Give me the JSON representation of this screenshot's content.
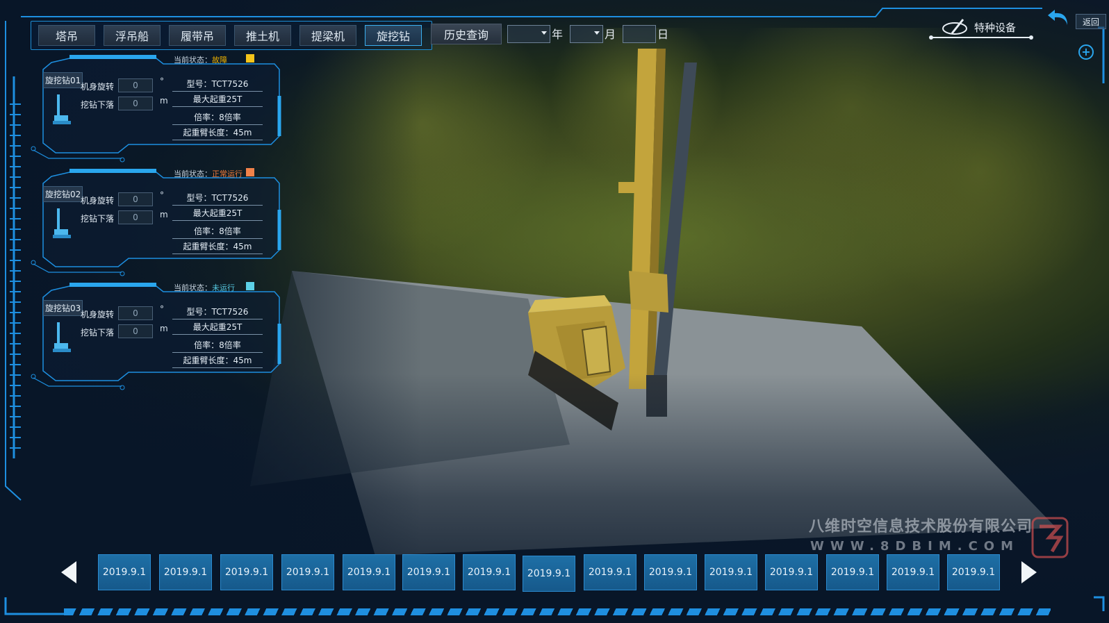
{
  "tabs": [
    {
      "label": "塔吊"
    },
    {
      "label": "浮吊船"
    },
    {
      "label": "履带吊"
    },
    {
      "label": "推土机"
    },
    {
      "label": "提梁机"
    },
    {
      "label": "旋挖钻",
      "active": true
    }
  ],
  "history": {
    "button_label": "历史查询",
    "year_unit": "年",
    "month_unit": "月",
    "day_unit": "日"
  },
  "header_right": {
    "brand_label": "特种设备",
    "back_label": "返回"
  },
  "devices": [
    {
      "status_prefix": "当前状态：",
      "status": "故障",
      "status_color": "#f0b400",
      "swatch_color": "#f4c41a",
      "name": "旋挖钻01",
      "rotation_label": "机身旋转",
      "rotation_value": "0",
      "rotation_unit": "°",
      "drop_label": "挖钻下落",
      "drop_value": "0",
      "drop_unit": "m",
      "model": "型号：TCT7526",
      "max_load": "最大起重25T",
      "ratio": "倍率：8倍率",
      "boom": "起重臂长度：45m"
    },
    {
      "status_prefix": "当前状态：",
      "status": "正常运行",
      "status_color": "#f07a3a",
      "swatch_color": "#f0824a",
      "name": "旋挖钻02",
      "rotation_label": "机身旋转",
      "rotation_value": "0",
      "rotation_unit": "°",
      "drop_label": "挖钻下落",
      "drop_value": "0",
      "drop_unit": "m",
      "model": "型号：TCT7526",
      "max_load": "最大起重25T",
      "ratio": "倍率：8倍率",
      "boom": "起重臂长度：45m"
    },
    {
      "status_prefix": "当前状态：",
      "status": "未运行",
      "status_color": "#56c8e0",
      "swatch_color": "#5cd0e6",
      "name": "旋挖钻03",
      "rotation_label": "机身旋转",
      "rotation_value": "0",
      "rotation_unit": "°",
      "drop_label": "挖钻下落",
      "drop_value": "0",
      "drop_unit": "m",
      "model": "型号：TCT7526",
      "max_load": "最大起重25T",
      "ratio": "倍率：8倍率",
      "boom": "起重臂长度：45m"
    }
  ],
  "timeline": {
    "dates": [
      "2019.9.1",
      "2019.9.1",
      "2019.9.1",
      "2019.9.1",
      "2019.9.1",
      "2019.9.1",
      "2019.9.1",
      "2019.9.1",
      "2019.9.1",
      "2019.9.1",
      "2019.9.1",
      "2019.9.1",
      "2019.9.1",
      "2019.9.1",
      "2019.9.1"
    ]
  },
  "watermark": {
    "company": "八维时空信息技术股份有限公司",
    "url": "WWW.8DBIM.COM"
  },
  "icons": [
    "back-arrow-icon",
    "plus-circle-icon",
    "brand-logo-icon",
    "rig-icon",
    "prev-arrow-icon",
    "next-arrow-icon",
    "dropdown-arrow-icon"
  ]
}
